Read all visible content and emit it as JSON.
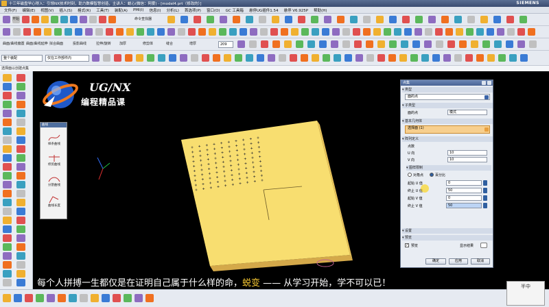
{
  "window": {
    "title": "十三年磁盘学心得入：引领NX技术时刻，助力数模智慧创造，主讲人：蜕心(微信：阿雾) - [model4.prt（修改的）]",
    "brand": "SIEMENS"
  },
  "menu": [
    "文件(F)",
    "编辑(E)",
    "视图(V)",
    "插入(S)",
    "格式(R)",
    "工具(T)",
    "装配(A)",
    "PMI(I)",
    "信息(I)",
    "分析(L)",
    "首选项(P)",
    "窗口(O)",
    "GC 工具箱",
    "悬停UG插件1.54",
    "悬停 V6.925P",
    "帮助(H)"
  ],
  "toolbar": {
    "start_label": "开始",
    "command_finder": "命令查找器",
    "row3_labels": [
      "曲面/曲线偏置",
      "曲面/曲线延伸",
      "拟合曲面",
      "投影曲线",
      "拉伸/旋转",
      "加厚",
      "修剪体",
      "缝合",
      "增厚"
    ],
    "zoom_value": "209",
    "filter_label": "仅在工作部件内",
    "snap_label": "整个装配"
  },
  "status_text": "选择面以创建点集",
  "logo": {
    "title": "UG/NX",
    "subtitle": "编程精品课"
  },
  "palette": {
    "title": "曲线",
    "items": [
      "样条曲线",
      "修剪曲线",
      "分割曲线",
      "曲线长度"
    ]
  },
  "dialog": {
    "title": "点集",
    "type_label": "类型",
    "type_value": "面的点",
    "subtype_label": "子类型",
    "subtype_field": "面的点",
    "subtype_option": "模式",
    "base_label": "基本几何体",
    "select_face": "选择面 (1)",
    "pattern_label": "阵列定义",
    "count_label": "点数",
    "u_label": "U 向",
    "u_value": "10",
    "v_label": "V 向",
    "v_value": "10",
    "limits_label": "图样限制",
    "radio_a": "对角点",
    "radio_b": "百分比",
    "start_u_label": "起始 U 值",
    "start_u": "0",
    "end_u_label": "终止 U 值",
    "end_u": "50",
    "start_v_label": "起始 V 值",
    "start_v": "0",
    "end_v_label": "终止 V 值",
    "end_v": "50",
    "settings_label": "设置",
    "preview_label": "预览",
    "preview_check": "预览",
    "show_result": "显示结果",
    "ok": "确定",
    "apply": "应用",
    "cancel": "取消"
  },
  "subtitle": {
    "before": "每个人拼搏一生都仅是在证明自己属于什么样的命，",
    "accent": "蜕变",
    "after": " —— 从学习开始，学不可以已！"
  },
  "colors": {
    "part_top": "#f9e072",
    "part_side": "#e6be52",
    "accent": "#f4c632",
    "title_bar": "#4a6495"
  },
  "corner_text": "半中"
}
